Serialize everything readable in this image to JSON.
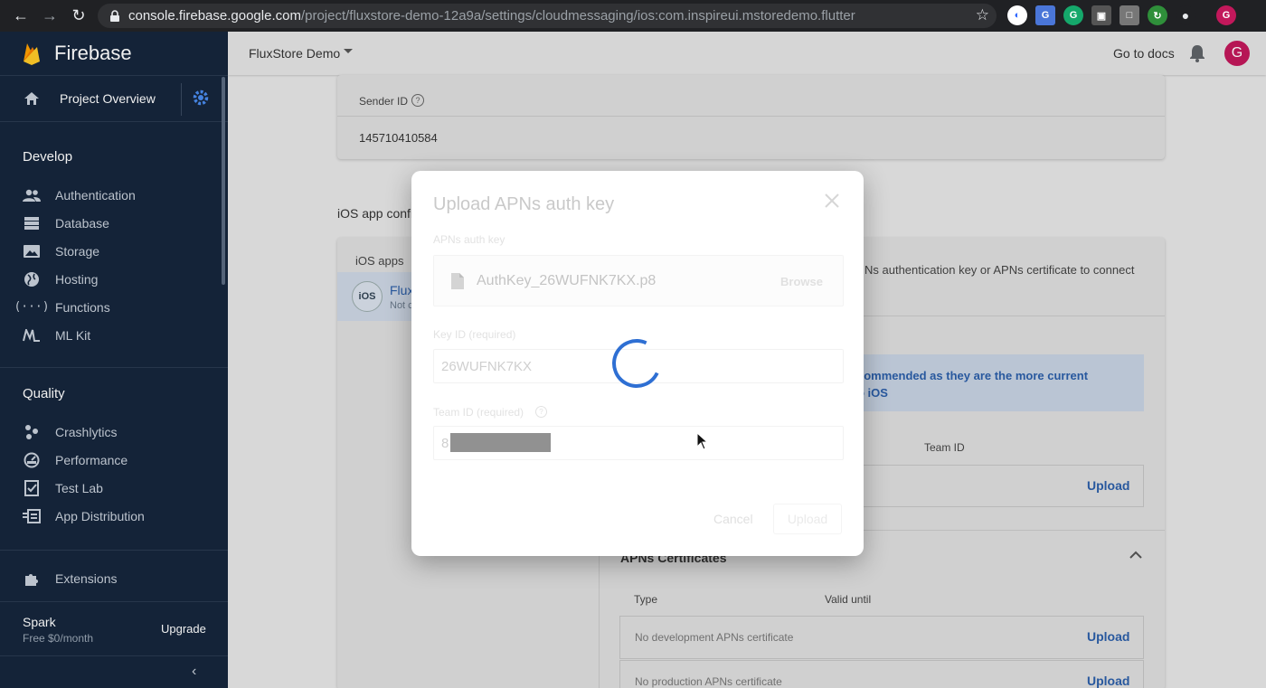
{
  "browser": {
    "url_host": "console.firebase.google.com",
    "url_path": "/project/fluxstore-demo-12a9a/settings/cloudmessaging/ios:com.inspireui.mstoredemo.flutter",
    "profile_initial": "G"
  },
  "sidebar": {
    "brand": "Firebase",
    "overview": "Project Overview",
    "develop_title": "Develop",
    "develop_items": [
      {
        "label": "Authentication",
        "icon": "people-icon"
      },
      {
        "label": "Database",
        "icon": "database-icon"
      },
      {
        "label": "Storage",
        "icon": "image-icon"
      },
      {
        "label": "Hosting",
        "icon": "globe-icon"
      },
      {
        "label": "Functions",
        "icon": "functions-icon"
      },
      {
        "label": "ML Kit",
        "icon": "ml-icon"
      }
    ],
    "quality_title": "Quality",
    "quality_items": [
      {
        "label": "Crashlytics",
        "icon": "crash-icon"
      },
      {
        "label": "Performance",
        "icon": "speed-icon"
      },
      {
        "label": "Test Lab",
        "icon": "checklist-icon"
      },
      {
        "label": "App Distribution",
        "icon": "distribution-icon"
      }
    ],
    "extensions": "Extensions",
    "plan_name": "Spark",
    "plan_price": "Free $0/month",
    "upgrade": "Upgrade",
    "collapse": "‹"
  },
  "topbar": {
    "project": "FluxStore Demo",
    "docs": "Go to docs",
    "avatar_initial": "G"
  },
  "content": {
    "sender_label": "Sender ID",
    "sender_value": "145710410584",
    "ios_config": "iOS app confi",
    "apps_title": "iOS apps",
    "app_badge": "iOS",
    "app_name": "Flux",
    "app_sub": "Not c",
    "right_text": "Ns authentication key or APNs certificate to connect",
    "info_line1": "commended as they are the more current",
    "info_line2": "o iOS",
    "team_id_head": "Team ID",
    "upload": "Upload",
    "certs_title": "APNs Certificates",
    "col_type": "Type",
    "col_valid": "Valid until",
    "no_dev": "No development APNs certificate",
    "no_prod": "No production APNs certificate"
  },
  "modal": {
    "title": "Upload APNs auth key",
    "auth_key_label": "APNs auth key",
    "file_name": "AuthKey_26WUFNK7KX.p8",
    "browse": "Browse",
    "key_id_label": "Key ID (required)",
    "key_id_value": "26WUFNK7KX",
    "team_id_label": "Team ID (required)",
    "team_id_value": "8",
    "cancel": "Cancel",
    "upload": "Upload"
  },
  "colors": {
    "sidebar_bg": "#16263c",
    "accent_blue": "#2b5ea8",
    "spinner": "#2e6fd3"
  }
}
